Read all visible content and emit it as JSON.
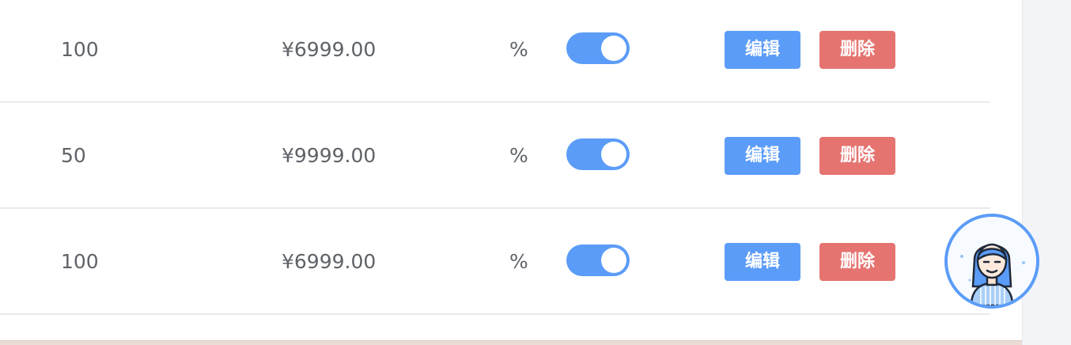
{
  "table": {
    "rows": [
      {
        "stock": "100",
        "price": "¥6999.00",
        "percent": "%",
        "enabled": true,
        "edit_label": "编辑",
        "delete_label": "删除"
      },
      {
        "stock": "50",
        "price": "¥9999.00",
        "percent": "%",
        "enabled": true,
        "edit_label": "编辑",
        "delete_label": "删除"
      },
      {
        "stock": "100",
        "price": "¥6999.00",
        "percent": "%",
        "enabled": true,
        "edit_label": "编辑",
        "delete_label": "删除"
      }
    ]
  },
  "colors": {
    "primary": "#5b9cf8",
    "danger": "#e57471",
    "text": "#5f6368",
    "divider": "#e9eaee"
  },
  "icons": {
    "toggle": "switch-on",
    "assistant": "support-agent-avatar"
  }
}
